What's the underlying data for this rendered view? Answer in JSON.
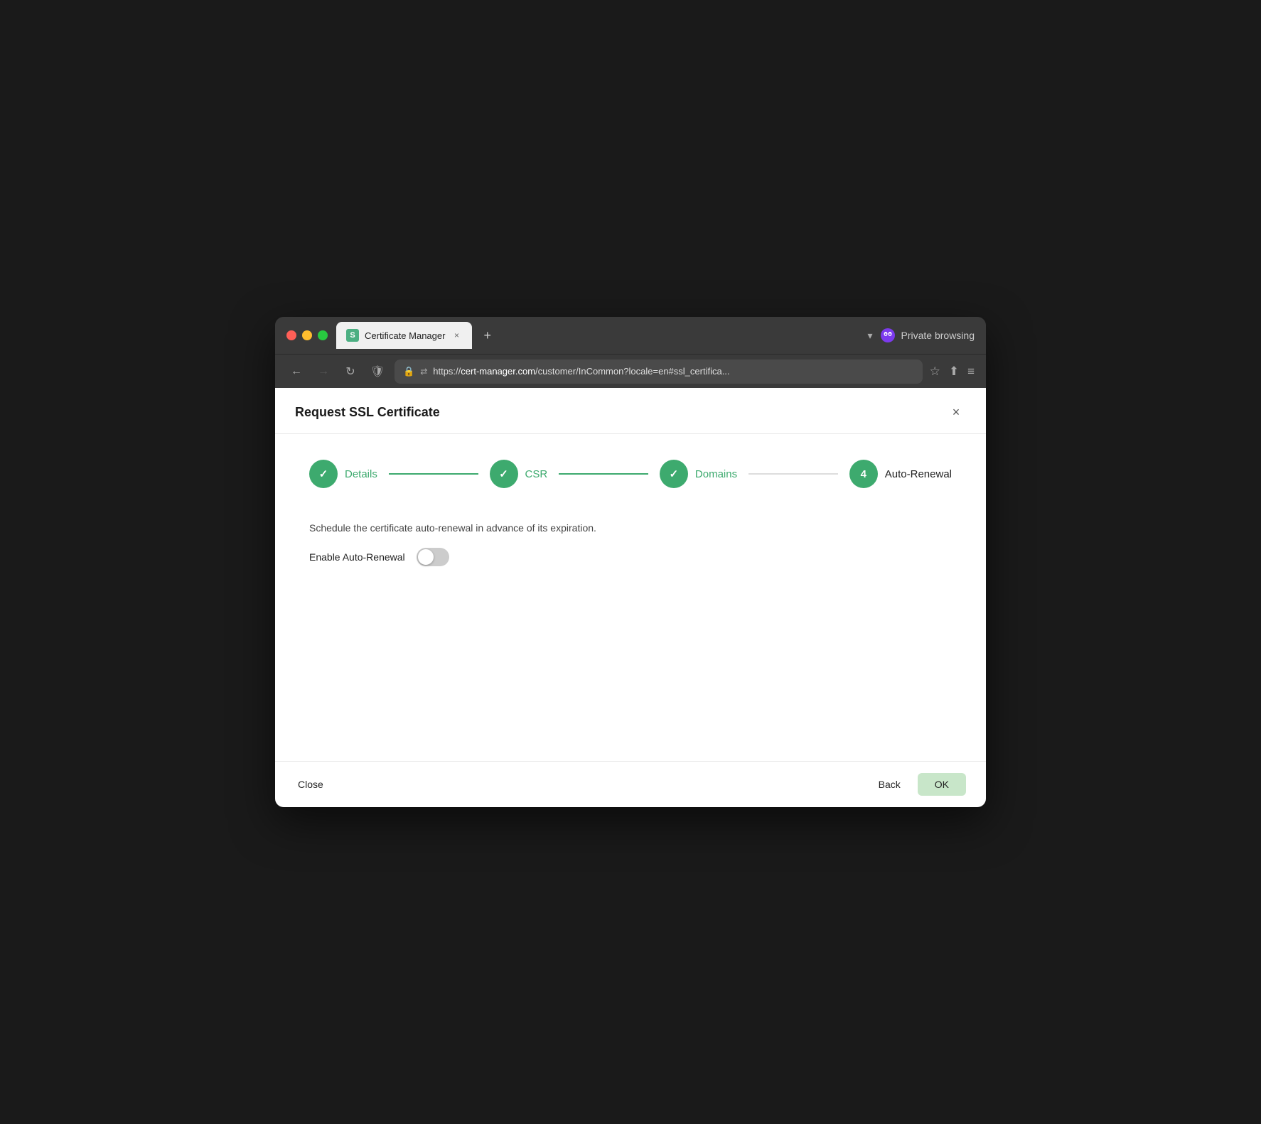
{
  "browser": {
    "traffic_lights": [
      "red",
      "yellow",
      "green"
    ],
    "tab": {
      "icon_letter": "S",
      "title": "Certificate Manager",
      "close_label": "×"
    },
    "new_tab_label": "+",
    "dropdown_arrow": "▾",
    "private_browsing_label": "Private browsing",
    "nav": {
      "back_label": "←",
      "forward_label": "→",
      "refresh_label": "↻",
      "address": {
        "protocol": "https://",
        "domain": "cert-manager.com",
        "path": "/customer/InCommon?locale=en#ssl_certifica..."
      },
      "star_label": "☆",
      "share_label": "⬆",
      "menu_label": "≡"
    }
  },
  "dialog": {
    "title": "Request SSL Certificate",
    "close_label": "×",
    "steps": [
      {
        "id": 1,
        "label": "Details",
        "state": "completed"
      },
      {
        "id": 2,
        "label": "CSR",
        "state": "completed"
      },
      {
        "id": 3,
        "label": "Domains",
        "state": "completed"
      },
      {
        "id": 4,
        "label": "Auto-Renewal",
        "state": "active"
      }
    ],
    "body": {
      "schedule_text": "Schedule the certificate auto-renewal in advance of its expiration.",
      "toggle_label": "Enable Auto-Renewal",
      "toggle_state": false
    },
    "footer": {
      "close_label": "Close",
      "back_label": "Back",
      "ok_label": "OK"
    }
  }
}
